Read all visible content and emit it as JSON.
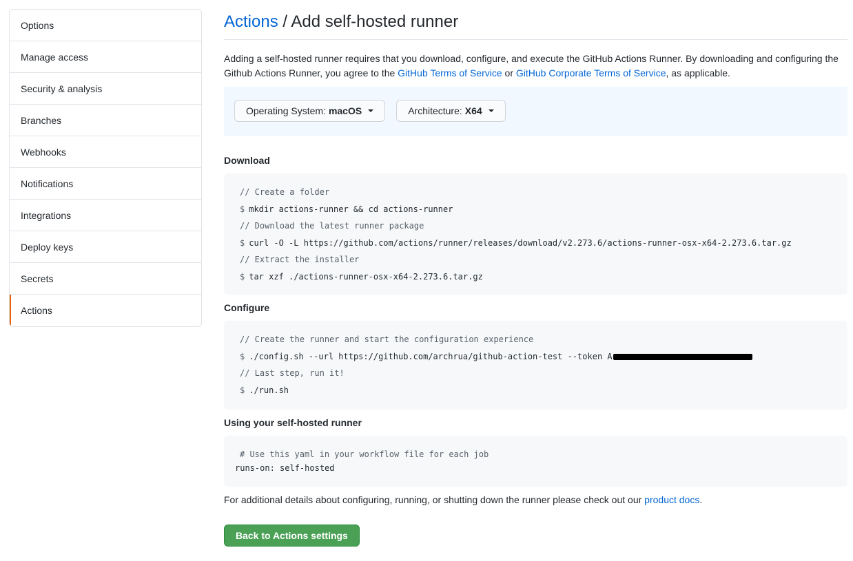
{
  "sidebar": {
    "items": [
      {
        "label": "Options"
      },
      {
        "label": "Manage access"
      },
      {
        "label": "Security & analysis"
      },
      {
        "label": "Branches"
      },
      {
        "label": "Webhooks"
      },
      {
        "label": "Notifications"
      },
      {
        "label": "Integrations"
      },
      {
        "label": "Deploy keys"
      },
      {
        "label": "Secrets"
      },
      {
        "label": "Actions"
      }
    ],
    "selected_color": "#e36209"
  },
  "header": {
    "breadcrumb_link": "Actions",
    "separator": " / ",
    "title": "Add self-hosted runner"
  },
  "intro": {
    "text1": "Adding a self-hosted runner requires that you download, configure, and execute the GitHub Actions Runner. By downloading and configuring the Github Actions Runner, you agree to the ",
    "link1": "GitHub Terms of Service",
    "text2": " or ",
    "link2": "GitHub Corporate Terms of Service",
    "text3": ", as applicable."
  },
  "selectors": {
    "os_label": "Operating System:",
    "os_value": "macOS",
    "arch_label": "Architecture:",
    "arch_value": "X64"
  },
  "download": {
    "title": "Download",
    "lines": [
      {
        "comment": "// Create a folder"
      },
      {
        "prompt": "$",
        "cmd": "mkdir actions-runner && cd actions-runner"
      },
      {
        "comment": "// Download the latest runner package"
      },
      {
        "prompt": "$",
        "cmd": "curl -O -L https://github.com/actions/runner/releases/download/v2.273.6/actions-runner-osx-x64-2.273.6.tar.gz"
      },
      {
        "comment": "// Extract the installer"
      },
      {
        "prompt": "$",
        "cmd": "tar xzf ./actions-runner-osx-x64-2.273.6.tar.gz"
      }
    ]
  },
  "configure": {
    "title": "Configure",
    "comment1": "// Create the runner and start the configuration experience",
    "prompt": "$",
    "config_cmd": "./config.sh --url https://github.com/archrua/github-action-test --token ",
    "token_visible": "A",
    "comment2": "// Last step, run it!",
    "run_cmd": "./run.sh"
  },
  "using": {
    "title": "Using your self-hosted runner",
    "comment": "# Use this yaml in your workflow file for each job",
    "yaml": "runs-on: self-hosted"
  },
  "docs": {
    "text": "For additional details about configuring, running, or shutting down the runner please check out our ",
    "link": "product docs",
    "suffix": "."
  },
  "back_button": {
    "label": "Back to Actions settings",
    "color": "#4aa055"
  }
}
